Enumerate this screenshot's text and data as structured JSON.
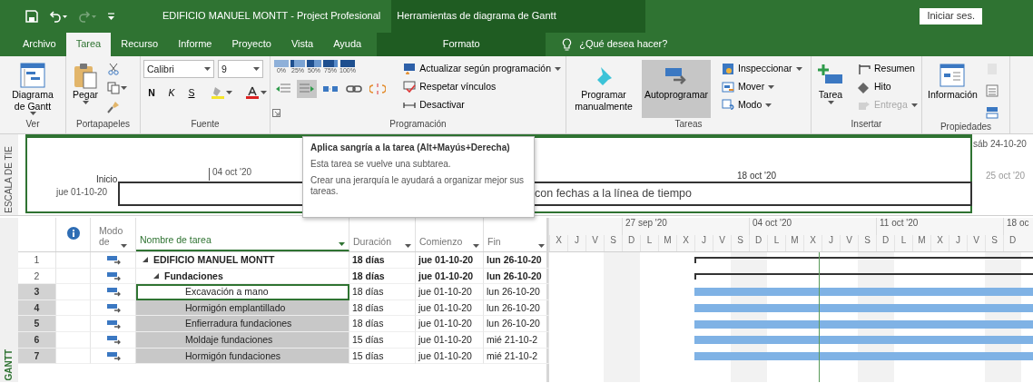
{
  "quick_access": [
    {
      "kind": "save",
      "disabled": false
    },
    {
      "kind": "undo",
      "disabled": false
    },
    {
      "kind": "redo",
      "disabled": true
    },
    {
      "kind": "customize",
      "disabled": false
    }
  ],
  "window": {
    "title": "EDIFICIO MANUEL MONTT - Project Profesional",
    "context_title": "Herramientas de diagrama de Gantt",
    "sign_in": "Iniciar ses."
  },
  "tabs": [
    {
      "label": "Archivo",
      "selected": false,
      "kind": "main"
    },
    {
      "label": "Tarea",
      "selected": true,
      "kind": "main"
    },
    {
      "label": "Recurso",
      "selected": false,
      "kind": "main"
    },
    {
      "label": "Informe",
      "selected": false,
      "kind": "main"
    },
    {
      "label": "Proyecto",
      "selected": false,
      "kind": "main"
    },
    {
      "label": "Vista",
      "selected": false,
      "kind": "main"
    },
    {
      "label": "Ayuda",
      "selected": false,
      "kind": "main"
    },
    {
      "label": "Formato",
      "selected": false,
      "kind": "context"
    }
  ],
  "search": {
    "placeholder": "¿Qué desea hacer?"
  },
  "ribbon": [
    {
      "kind": "view",
      "label": "Ver",
      "large": [
        {
          "label": "Diagrama de Gantt",
          "dropdown": true
        }
      ]
    },
    {
      "kind": "clipboard",
      "label": "Portapapeles",
      "large": [
        {
          "label": "Pegar",
          "dropdown": true
        }
      ],
      "tools": [
        {
          "dropdown": false
        },
        {
          "dropdown": true
        },
        {
          "dropdown": false
        }
      ]
    },
    {
      "kind": "font",
      "label": "Fuente",
      "font": "Calibri",
      "size": "9",
      "styles": [
        "N",
        "K",
        "S"
      ],
      "tools": [
        {
          "dropdown": true
        },
        {
          "dropdown": true
        }
      ]
    },
    {
      "kind": "schedule",
      "label": "Programación",
      "percents": [
        "0%",
        "25%",
        "50%",
        "75%",
        "100%"
      ],
      "tools": [
        {
          "hovered": false
        },
        {
          "hovered": true
        },
        {
          "hovered": false
        },
        {
          "hovered": false
        },
        {
          "hovered": false
        }
      ],
      "small": [
        {
          "label": "Actualizar según programación",
          "dropdown": true,
          "disabled": false
        },
        {
          "label": "Respetar vínculos",
          "dropdown": false,
          "disabled": false
        },
        {
          "label": "Desactivar",
          "dropdown": false,
          "disabled": false
        }
      ]
    },
    {
      "kind": "tasks",
      "label": "Tareas",
      "large": [
        {
          "label": "Programar manualmente",
          "selected": false
        },
        {
          "label": "Autoprogramar",
          "selected": true
        }
      ],
      "small": [
        {
          "label": "Inspeccionar",
          "dropdown": true,
          "disabled": false
        },
        {
          "label": "Mover",
          "dropdown": true,
          "disabled": false
        },
        {
          "label": "Modo",
          "dropdown": true,
          "disabled": false
        }
      ]
    },
    {
      "kind": "insert",
      "label": "Insertar",
      "large": [
        {
          "label": "Tarea",
          "dropdown": true
        }
      ],
      "small": [
        {
          "label": "Resumen",
          "dropdown": false,
          "disabled": false
        },
        {
          "label": "Hito",
          "dropdown": false,
          "disabled": false
        },
        {
          "label": "Entrega",
          "dropdown": true,
          "disabled": true
        }
      ]
    },
    {
      "kind": "properties",
      "label": "Propiedades",
      "large": [
        {
          "label": "Información"
        }
      ],
      "tools": [
        {
          "disabled": true
        },
        {
          "disabled": false
        },
        {
          "disabled": false
        }
      ]
    }
  ],
  "timeline": {
    "side_label": "ESCALA DE TIE",
    "start_label": "Inicio",
    "start_date": "jue 01-10-20",
    "finish_date": "sáb 24-10-20",
    "ticks": [
      "04 oct '20",
      "18 oct '20",
      "25 oct '20"
    ],
    "hint": "con fechas a la línea de tiempo"
  },
  "tooltip": {
    "title": "Aplica sangría a la tarea (Alt+Mayús+Derecha)",
    "lines": [
      "Esta tarea se vuelve una subtarea.",
      "Crear una jerarquía le ayudará a organizar mejor sus tareas."
    ]
  },
  "view_label": "GANTT",
  "table": {
    "columns": [
      {
        "kind": "info",
        "selected": false
      },
      {
        "label": "Modo de",
        "kind": "mode",
        "selected": false
      },
      {
        "label": "Nombre de tarea",
        "kind": "name",
        "selected": true
      },
      {
        "label": "Duración",
        "kind": "duration",
        "selected": false
      },
      {
        "label": "Comienzo",
        "kind": "start",
        "selected": false
      },
      {
        "label": "Fin",
        "kind": "finish",
        "selected": false
      }
    ],
    "rows": [
      {
        "number": "1",
        "name": "EDIFICIO MANUEL MONTT",
        "duration": "18 días",
        "start": "jue 01-10-20",
        "finish": "lun 26-10-20",
        "kind": "summary",
        "expanded": true,
        "selected": false,
        "active": false,
        "children": [
          {
            "number": "2",
            "name": "Fundaciones",
            "duration": "18 días",
            "start": "jue 01-10-20",
            "finish": "lun 26-10-20",
            "kind": "summary",
            "expanded": true,
            "selected": false,
            "active": false,
            "children": [
              {
                "number": "3",
                "name": "Excavación a mano",
                "duration": "18 días",
                "start": "jue 01-10-20",
                "finish": "lun 26-10-20",
                "kind": "task",
                "selected": true,
                "active": true
              },
              {
                "number": "4",
                "name": "Hormigón emplantillado",
                "duration": "18 días",
                "start": "jue 01-10-20",
                "finish": "lun 26-10-20",
                "kind": "task",
                "selected": true,
                "active": false
              },
              {
                "number": "5",
                "name": "Enfierradura fundaciones",
                "duration": "18 días",
                "start": "jue 01-10-20",
                "finish": "lun 26-10-20",
                "kind": "task",
                "selected": true,
                "active": false
              },
              {
                "number": "6",
                "name": "Moldaje fundaciones",
                "duration": "15 días",
                "start": "jue 01-10-20",
                "finish": "mié 21-10-2",
                "kind": "task",
                "selected": true,
                "active": false
              },
              {
                "number": "7",
                "name": "Hormigón fundaciones",
                "duration": "15 días",
                "start": "jue 01-10-20",
                "finish": "mié 21-10-2",
                "kind": "task",
                "selected": true,
                "active": false
              }
            ]
          }
        ]
      }
    ]
  },
  "gantt": {
    "weeks": [
      "27 sep '20",
      "04 oct '20",
      "11 oct '20",
      "18 oc"
    ],
    "days": [
      "X",
      "J",
      "V",
      "S",
      "D",
      "L",
      "M",
      "X",
      "J",
      "V",
      "S",
      "D",
      "L",
      "M",
      "X",
      "J",
      "V",
      "S",
      "D",
      "L",
      "M",
      "X",
      "J",
      "V",
      "S",
      "D"
    ]
  }
}
